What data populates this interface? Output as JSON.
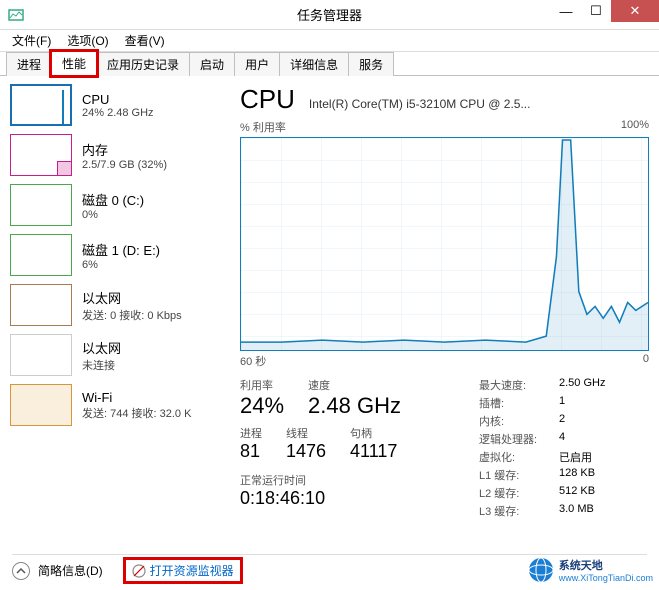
{
  "window": {
    "title": "任务管理器"
  },
  "menu": {
    "file": "文件(F)",
    "options": "选项(O)",
    "view": "查看(V)"
  },
  "tabs": {
    "processes": "进程",
    "performance": "性能",
    "app_history": "应用历史记录",
    "startup": "启动",
    "users": "用户",
    "details": "详细信息",
    "services": "服务"
  },
  "sidebar": [
    {
      "title": "CPU",
      "sub": "24% 2.48 GHz"
    },
    {
      "title": "内存",
      "sub": "2.5/7.9 GB (32%)"
    },
    {
      "title": "磁盘 0 (C:)",
      "sub": "0%"
    },
    {
      "title": "磁盘 1 (D: E:)",
      "sub": "6%"
    },
    {
      "title": "以太网",
      "sub": "发送: 0 接收: 0 Kbps"
    },
    {
      "title": "以太网",
      "sub": "未连接"
    },
    {
      "title": "Wi-Fi",
      "sub": "发送: 744 接收: 32.0 K"
    }
  ],
  "main": {
    "title": "CPU",
    "subtitle": "Intel(R) Core(TM) i5-3210M CPU @ 2.5...",
    "y_label": "% 利用率",
    "y_max": "100%",
    "x_left": "60 秒",
    "x_right": "0"
  },
  "stats": {
    "util_label": "利用率",
    "util": "24%",
    "speed_label": "速度",
    "speed": "2.48 GHz",
    "proc_label": "进程",
    "proc": "81",
    "thread_label": "线程",
    "thread": "1476",
    "handle_label": "句柄",
    "handle": "41117",
    "uptime_label": "正常运行时间",
    "uptime": "0:18:46:10"
  },
  "spec": {
    "max_speed_k": "最大速度:",
    "max_speed_v": "2.50 GHz",
    "sockets_k": "插槽:",
    "sockets_v": "1",
    "cores_k": "内核:",
    "cores_v": "2",
    "lp_k": "逻辑处理器:",
    "lp_v": "4",
    "virt_k": "虚拟化:",
    "virt_v": "已启用",
    "l1_k": "L1 缓存:",
    "l1_v": "128 KB",
    "l2_k": "L2 缓存:",
    "l2_v": "512 KB",
    "l3_k": "L3 缓存:",
    "l3_v": "3.0 MB"
  },
  "footer": {
    "brief": "简略信息(D)",
    "resource_monitor": "打开资源监视器"
  },
  "watermark": {
    "brand": "系统天地",
    "url": "www.XiTongTianDi.com"
  },
  "chart_data": {
    "type": "line",
    "title": "CPU % 利用率",
    "xlabel": "秒",
    "ylabel": "% 利用率",
    "ylim": [
      0,
      100
    ],
    "xlim": [
      60,
      0
    ],
    "x": [
      60,
      55,
      50,
      45,
      40,
      35,
      30,
      25,
      20,
      15,
      12,
      11,
      10,
      9,
      8,
      7,
      6,
      5,
      4,
      3,
      2,
      1,
      0
    ],
    "values": [
      4,
      4,
      5,
      4,
      5,
      4,
      5,
      4,
      5,
      5,
      8,
      40,
      100,
      100,
      30,
      18,
      22,
      16,
      22,
      14,
      24,
      20,
      24
    ]
  }
}
